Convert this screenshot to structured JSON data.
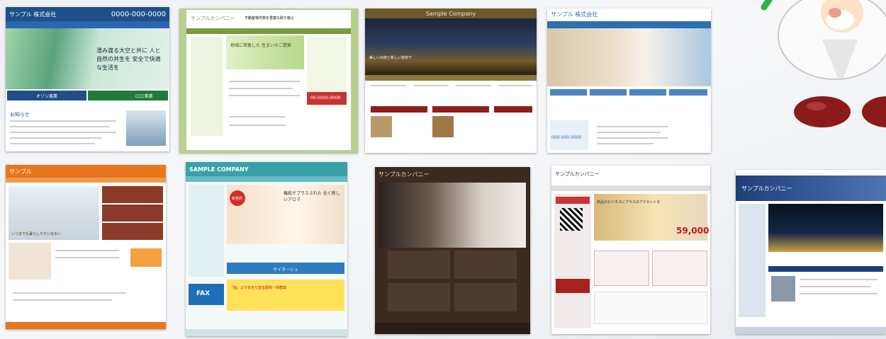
{
  "thumbnails": [
    {
      "title": "サンプル 株式会社",
      "phone": "0000-000-0000",
      "hero_text": "澄み渡る大空と共に 人と自然の共生を 安全で快適な生活を",
      "banner_left": "オゾン事業",
      "banner_right": "CCC事業",
      "news": "お知らせ",
      "theme": "#1e5a9e"
    },
    {
      "title": "サンプルカンパニー",
      "tagline": "不動産物件数を豊富な取り揃え",
      "hero_text": "地域に密着した 住まいのご提案",
      "phone": "00-0000-0000",
      "theme": "#7a9a3c"
    },
    {
      "title": "Sample Company",
      "hero_text": "美しい伝統と新しい技術で",
      "theme": "#6b5a2a"
    },
    {
      "title": "サンプル 株式会社",
      "phone": "000-000-0000",
      "theme": "#2c6fb3"
    },
    {
      "title": "サンプル",
      "hero_text": "いつまでも暮らしやすい住まい",
      "theme": "#e8771c"
    },
    {
      "title": "SAMPLE COMPANY",
      "hero_text": "機能がプラスされた 全く新しいアロマ",
      "badge": "新発売",
      "promo1": "サイネーシュ",
      "promo2": "「塩」より安全な害虫駆除・除菌薬",
      "promo3": "FAX",
      "theme": "#3aa0a8"
    },
    {
      "title": "サンプルカンパニー",
      "theme": "#3a2a22"
    },
    {
      "title": "サンプルカンパニー",
      "hero_text": "商品のビジネスにプラスのアクセントを",
      "price": "59,000",
      "theme": "#b52a2a"
    },
    {
      "title": "サンプルカンパニー",
      "theme": "#1e3f78"
    }
  ]
}
